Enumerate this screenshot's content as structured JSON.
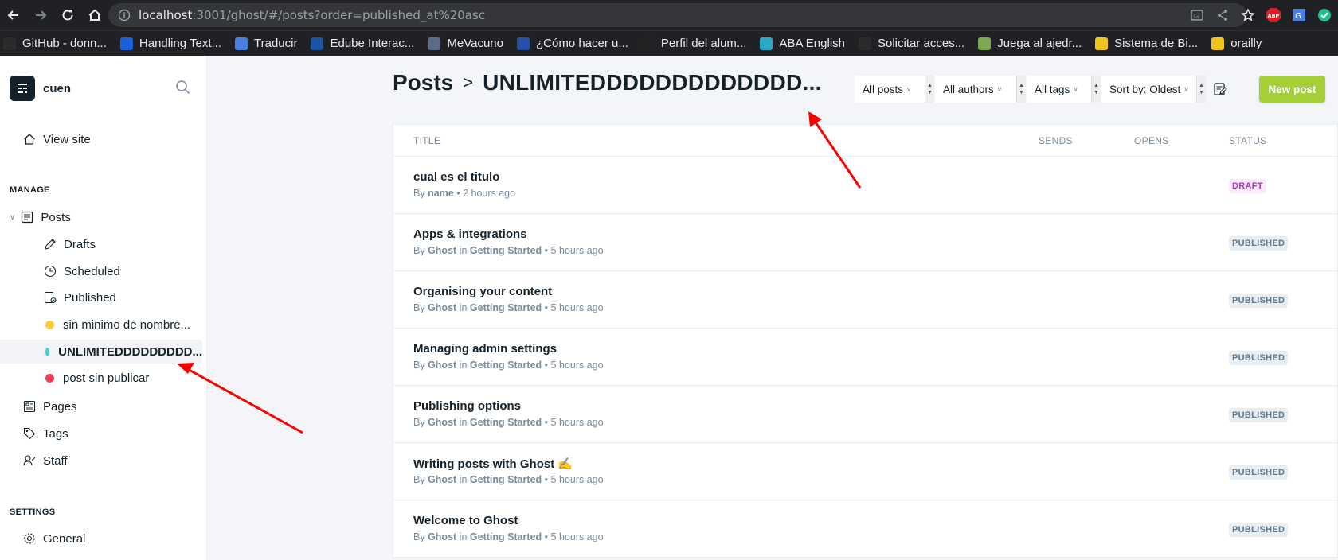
{
  "browser": {
    "url_host": "localhost",
    "url_rest": ":3001/ghost/#/posts?order=published_at%20asc",
    "bookmarks": [
      {
        "label": "GitHub - donn...",
        "color": "#2b2b2b",
        "icon": "github-icon"
      },
      {
        "label": "Handling Text...",
        "color": "#1a5fdc",
        "icon": "c-icon"
      },
      {
        "label": "Traducir",
        "color": "#4a7fe0",
        "icon": "translate-icon"
      },
      {
        "label": "Edube Interac...",
        "color": "#1b56a4",
        "icon": "edube-icon"
      },
      {
        "label": "MeVacuno",
        "color": "#5a6c86",
        "icon": "syringe-icon"
      },
      {
        "label": "¿Cómo hacer u...",
        "color": "#2a4fa8",
        "icon": "page-icon"
      },
      {
        "label": "Perfil del alum...",
        "color": "#222222",
        "icon": "page-icon"
      },
      {
        "label": "ABA English",
        "color": "#2aa8c5",
        "icon": "aba-icon"
      },
      {
        "label": "Solicitar acces...",
        "color": "#2b2b2b",
        "icon": "github-icon"
      },
      {
        "label": "Juega al ajedr...",
        "color": "#7fa650",
        "icon": "chess-icon"
      },
      {
        "label": "Sistema de Bi...",
        "color": "#f0c419",
        "icon": "library-icon"
      },
      {
        "label": "orailly",
        "color": "#f0c419",
        "icon": "library-icon"
      }
    ],
    "ext_labels": {
      "abp": "ABP"
    }
  },
  "sidebar": {
    "brand": "cuen",
    "view_site": "View site",
    "manage_heading": "MANAGE",
    "posts": "Posts",
    "drafts": "Drafts",
    "scheduled": "Scheduled",
    "published": "Published",
    "custom_views": [
      {
        "label": "sin minimo de nombre...",
        "color": "#fecd2f"
      },
      {
        "label": "UNLIMITEDDDDDDDDD...",
        "color": "#44d0d9"
      },
      {
        "label": "post sin publicar",
        "color": "#f33d55"
      }
    ],
    "pages": "Pages",
    "tags": "Tags",
    "staff": "Staff",
    "settings_heading": "SETTINGS",
    "general": "General"
  },
  "main": {
    "crumb_root": "Posts",
    "crumb_sep": ">",
    "crumb_current": "UNLIMITEDDDDDDDDDDDDD...",
    "filters": {
      "type": "All posts",
      "authors": "All authors",
      "tags": "All tags",
      "sort": "Sort by: Oldest"
    },
    "new_post": "New post",
    "columns": {
      "title": "TITLE",
      "sends": "SENDS",
      "opens": "OPENS",
      "status": "STATUS"
    },
    "posts": [
      {
        "title": "cual es el titulo",
        "by": "By",
        "author": "name",
        "in": "",
        "tag": "",
        "time": "• 2 hours ago",
        "status": "DRAFT"
      },
      {
        "title": "Apps & integrations",
        "by": "By",
        "author": "Ghost",
        "in": "in",
        "tag": "Getting Started",
        "time": "• 5 hours ago",
        "status": "PUBLISHED"
      },
      {
        "title": "Organising your content",
        "by": "By",
        "author": "Ghost",
        "in": "in",
        "tag": "Getting Started",
        "time": "• 5 hours ago",
        "status": "PUBLISHED"
      },
      {
        "title": "Managing admin settings",
        "by": "By",
        "author": "Ghost",
        "in": "in",
        "tag": "Getting Started",
        "time": "• 5 hours ago",
        "status": "PUBLISHED"
      },
      {
        "title": "Publishing options",
        "by": "By",
        "author": "Ghost",
        "in": "in",
        "tag": "Getting Started",
        "time": "• 5 hours ago",
        "status": "PUBLISHED"
      },
      {
        "title": "Writing posts with Ghost ✍️",
        "by": "By",
        "author": "Ghost",
        "in": "in",
        "tag": "Getting Started",
        "time": "• 5 hours ago",
        "status": "PUBLISHED"
      },
      {
        "title": "Welcome to Ghost",
        "by": "By",
        "author": "Ghost",
        "in": "in",
        "tag": "Getting Started",
        "time": "• 5 hours ago",
        "status": "PUBLISHED"
      }
    ]
  },
  "colors": {
    "accent_green": "#a4d037",
    "annotation_red": "#ff0000"
  }
}
